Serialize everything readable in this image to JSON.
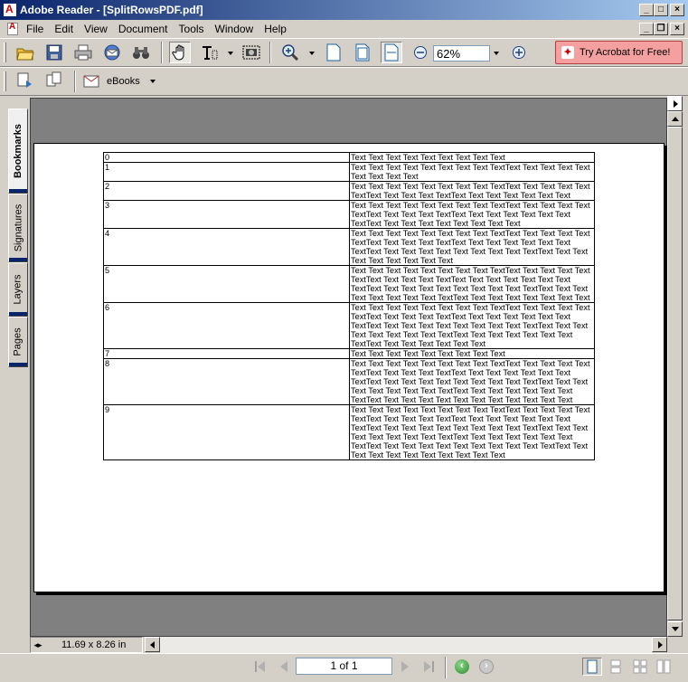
{
  "window": {
    "title": "Adobe Reader - [SplitRowsPDF.pdf]"
  },
  "menu": [
    "File",
    "Edit",
    "View",
    "Document",
    "Tools",
    "Window",
    "Help"
  ],
  "toolbar": {
    "zoom_value": "62%",
    "promo_label": "Try Acrobat for Free!",
    "ebooks_label": "eBooks"
  },
  "side_tabs": [
    "Bookmarks",
    "Signatures",
    "Layers",
    "Pages"
  ],
  "document": {
    "rows": [
      {
        "num": "0",
        "text": "Text Text Text Text Text Text Text Text Text"
      },
      {
        "num": "1",
        "text": "Text Text Text Text Text Text Text Text TextText Text Text Text Text Text Text Text Text"
      },
      {
        "num": "2",
        "text": "Text Text Text Text Text Text Text Text TextText Text Text Text Text TextText Text Text Text TextText Text Text Text Text Text Text"
      },
      {
        "num": "3",
        "text": "Text Text Text Text Text Text Text Text TextText Text Text Text Text TextText Text Text Text TextText Text Text Text Text Text Text TextText Text Text Text Text Text Text Text Text"
      },
      {
        "num": "4",
        "text": "Text Text Text Text Text Text Text Text TextText Text Text Text Text TextText Text Text Text TextText Text Text Text Text Text Text TextText Text Text Text Text Text Text Text Text TextText Text Text Text Text Text Text Text Text"
      },
      {
        "num": "5",
        "text": "Text Text Text Text Text Text Text Text TextText Text Text Text Text TextText Text Text Text TextText Text Text Text Text Text Text TextText Text Text Text Text Text Text Text Text TextText Text Text Text Text Text Text Text TextText Text Text Text Text Text Text Text"
      },
      {
        "num": "6",
        "text": "Text Text Text Text Text Text Text Text TextText Text Text Text Text TextText Text Text Text TextText Text Text Text Text Text Text TextText Text Text Text Text Text Text Text Text TextText Text Text Text Text Text Text Text TextText Text Text Text Text Text Text TextText Text Text Text Text Text Text"
      },
      {
        "num": "7",
        "text": "Text Text Text Text Text Text Text Text Text"
      },
      {
        "num": "8",
        "text": "Text Text Text Text Text Text Text Text TextText Text Text Text Text TextText Text Text Text TextText Text Text Text Text Text Text TextText Text Text Text Text Text Text Text Text TextText Text Text Text Text Text Text Text TextText Text Text Text Text Text Text TextText Text Text Text Text Text Text Text Text Text Text Text"
      },
      {
        "num": "9",
        "text": "Text Text Text Text Text Text Text Text TextText Text Text Text Text TextText Text Text Text TextText Text Text Text Text Text Text TextText Text Text Text Text Text Text Text Text TextText Text Text Text Text Text Text Text TextText Text Text Text Text Text Text TextText Text Text Text Text Text Text Text Text Text TextText Text Text Text Text Text Text Text Text Text Text"
      }
    ]
  },
  "status": {
    "page_size": "11.69 x 8.26 in",
    "page_indicator": "1 of 1"
  },
  "colors": {
    "titlebar": "#0a246a",
    "promo": "#f4a0a0",
    "chrome": "#d4d0c8",
    "doc_bg": "#808080"
  }
}
